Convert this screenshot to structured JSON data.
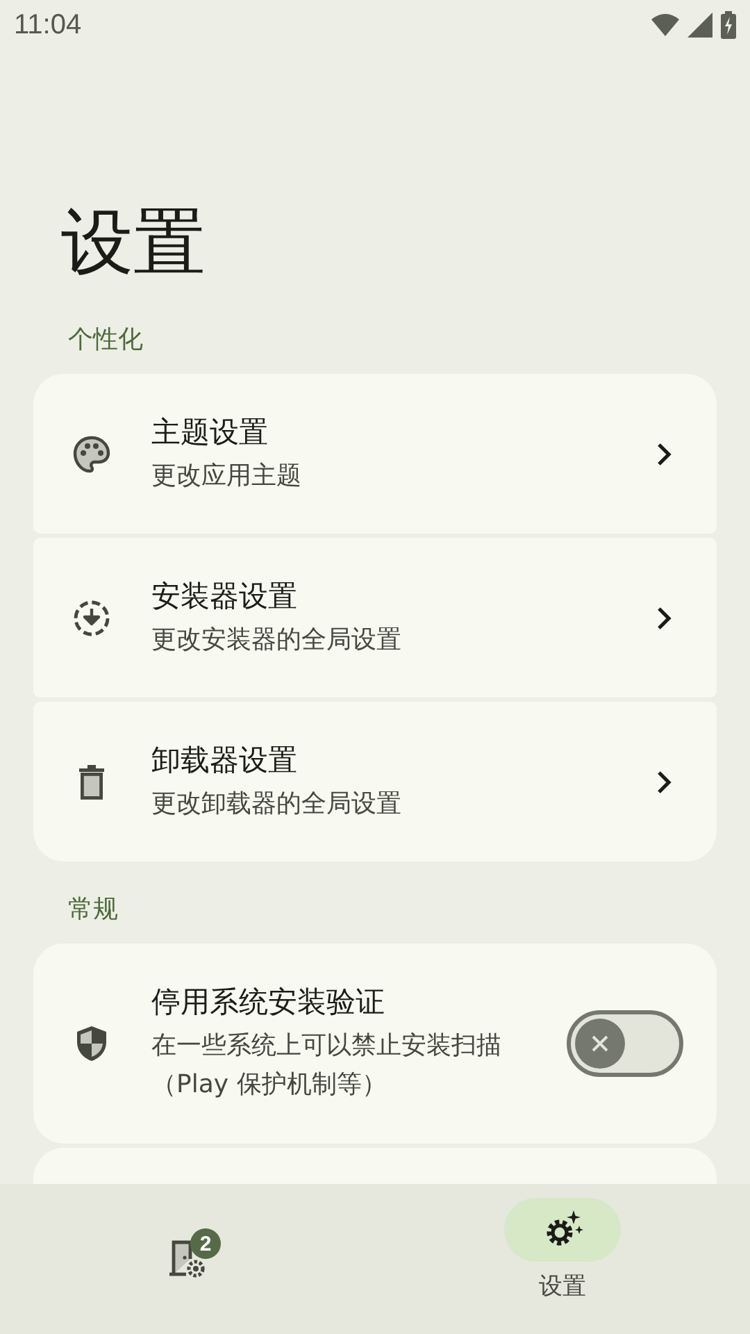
{
  "status_bar": {
    "time": "11:04"
  },
  "title": "设置",
  "sections": [
    {
      "label": "个性化",
      "items": [
        {
          "kind": "link",
          "title": "主题设置",
          "subtitle": "更改应用主题"
        },
        {
          "kind": "link",
          "title": "安装器设置",
          "subtitle": "更改安装器的全局设置"
        },
        {
          "kind": "link",
          "title": "卸载器设置",
          "subtitle": "更改卸载器的全局设置"
        }
      ]
    },
    {
      "label": "常规",
      "items": [
        {
          "kind": "switch",
          "title": "停用系统安装验证",
          "subtitle": "在一些系统上可以禁止安装扫描（Play 保护机制等）",
          "on": false
        }
      ]
    }
  ],
  "nav_items": [
    {
      "badge": "2",
      "selected": false
    },
    {
      "label": "设置",
      "selected": true
    }
  ]
}
